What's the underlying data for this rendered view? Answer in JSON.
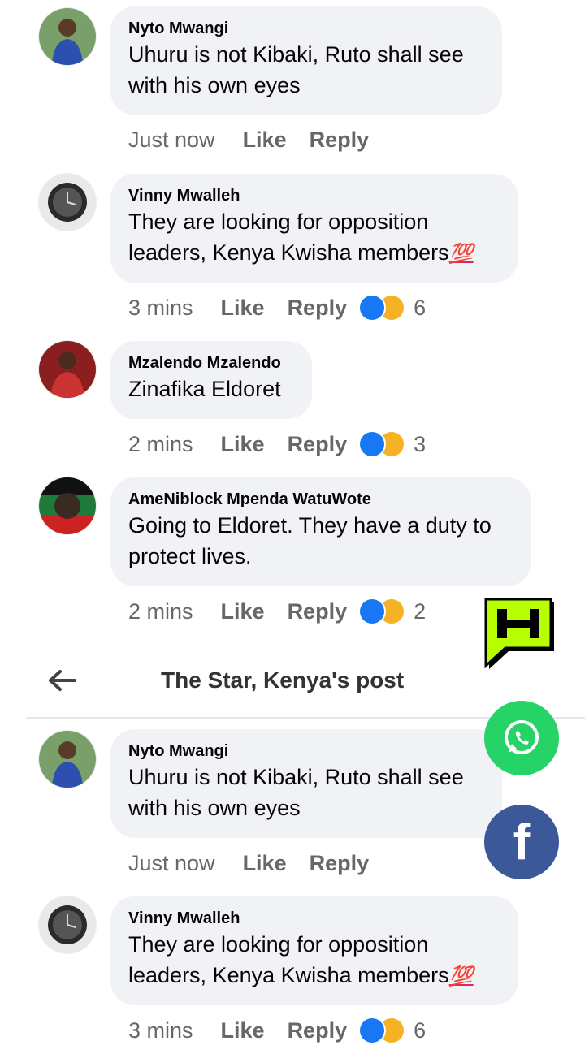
{
  "comments_top": [
    {
      "author": "Nyto Mwangi",
      "text": "Uhuru is not Kibaki, Ruto shall see with his own eyes",
      "time": "Just now",
      "like": "Like",
      "reply": "Reply",
      "reaction_count": ""
    },
    {
      "author": "Vinny Mwalleh",
      "text": "They are looking for opposition leaders, Kenya Kwisha members",
      "emoji": "💯",
      "time": "3 mins",
      "like": "Like",
      "reply": "Reply",
      "reaction_count": "6"
    },
    {
      "author": "Mzalendo Mzalendo",
      "text": "Zinafika Eldoret",
      "time": "2 mins",
      "like": "Like",
      "reply": "Reply",
      "reaction_count": "3"
    },
    {
      "author": "AmeNiblock Mpenda WatuWote",
      "text": "Going to Eldoret. They have a duty to protect lives.",
      "time": "2 mins",
      "like": "Like",
      "reply": "Reply",
      "reaction_count": "2"
    }
  ],
  "header": {
    "title": "The Star, Kenya's post",
    "back_icon": "back-arrow-icon"
  },
  "comments_bottom": [
    {
      "author": "Nyto Mwangi",
      "text": "Uhuru is not Kibaki, Ruto shall see with his own eyes",
      "time": "Just now",
      "like": "Like",
      "reply": "Reply",
      "reaction_count": ""
    },
    {
      "author": "Vinny Mwalleh",
      "text": "They are looking for opposition leaders, Kenya Kwisha members",
      "emoji": "💯",
      "time": "3 mins",
      "like": "Like",
      "reply": "Reply",
      "reaction_count": "6"
    }
  ],
  "overlay": {
    "facebook_glyph": "f"
  },
  "colors": {
    "bubble": "#f0f2f5",
    "meta": "#65676b",
    "like_reaction": "#1877f2",
    "haha_reaction": "#f7b125",
    "whatsapp": "#25d366",
    "facebook": "#3b5998",
    "h_logo": "#b5ff00"
  }
}
